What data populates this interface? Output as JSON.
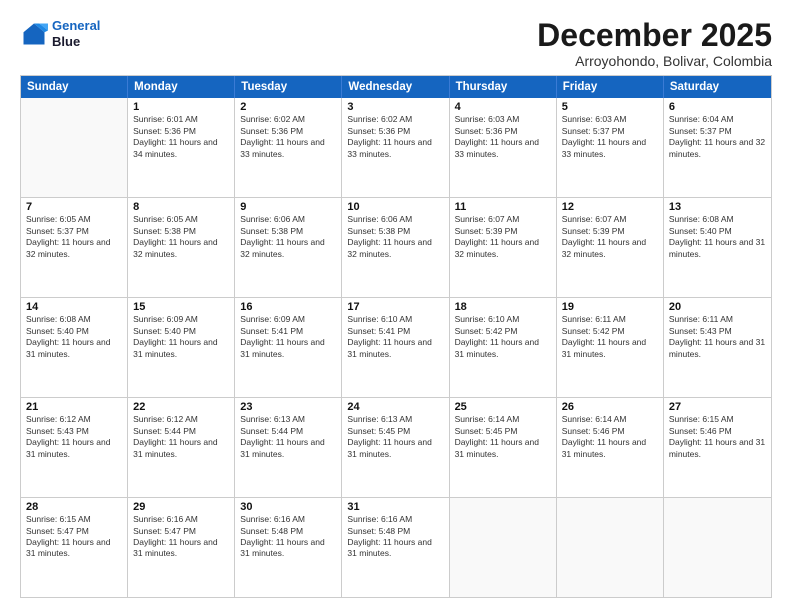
{
  "logo": {
    "line1": "General",
    "line2": "Blue"
  },
  "title": "December 2025",
  "subtitle": "Arroyohondo, Bolivar, Colombia",
  "headers": [
    "Sunday",
    "Monday",
    "Tuesday",
    "Wednesday",
    "Thursday",
    "Friday",
    "Saturday"
  ],
  "weeks": [
    [
      {
        "day": "",
        "sunrise": "",
        "sunset": "",
        "daylight": ""
      },
      {
        "day": "1",
        "sunrise": "Sunrise: 6:01 AM",
        "sunset": "Sunset: 5:36 PM",
        "daylight": "Daylight: 11 hours and 34 minutes."
      },
      {
        "day": "2",
        "sunrise": "Sunrise: 6:02 AM",
        "sunset": "Sunset: 5:36 PM",
        "daylight": "Daylight: 11 hours and 33 minutes."
      },
      {
        "day": "3",
        "sunrise": "Sunrise: 6:02 AM",
        "sunset": "Sunset: 5:36 PM",
        "daylight": "Daylight: 11 hours and 33 minutes."
      },
      {
        "day": "4",
        "sunrise": "Sunrise: 6:03 AM",
        "sunset": "Sunset: 5:36 PM",
        "daylight": "Daylight: 11 hours and 33 minutes."
      },
      {
        "day": "5",
        "sunrise": "Sunrise: 6:03 AM",
        "sunset": "Sunset: 5:37 PM",
        "daylight": "Daylight: 11 hours and 33 minutes."
      },
      {
        "day": "6",
        "sunrise": "Sunrise: 6:04 AM",
        "sunset": "Sunset: 5:37 PM",
        "daylight": "Daylight: 11 hours and 32 minutes."
      }
    ],
    [
      {
        "day": "7",
        "sunrise": "Sunrise: 6:05 AM",
        "sunset": "Sunset: 5:37 PM",
        "daylight": "Daylight: 11 hours and 32 minutes."
      },
      {
        "day": "8",
        "sunrise": "Sunrise: 6:05 AM",
        "sunset": "Sunset: 5:38 PM",
        "daylight": "Daylight: 11 hours and 32 minutes."
      },
      {
        "day": "9",
        "sunrise": "Sunrise: 6:06 AM",
        "sunset": "Sunset: 5:38 PM",
        "daylight": "Daylight: 11 hours and 32 minutes."
      },
      {
        "day": "10",
        "sunrise": "Sunrise: 6:06 AM",
        "sunset": "Sunset: 5:38 PM",
        "daylight": "Daylight: 11 hours and 32 minutes."
      },
      {
        "day": "11",
        "sunrise": "Sunrise: 6:07 AM",
        "sunset": "Sunset: 5:39 PM",
        "daylight": "Daylight: 11 hours and 32 minutes."
      },
      {
        "day": "12",
        "sunrise": "Sunrise: 6:07 AM",
        "sunset": "Sunset: 5:39 PM",
        "daylight": "Daylight: 11 hours and 32 minutes."
      },
      {
        "day": "13",
        "sunrise": "Sunrise: 6:08 AM",
        "sunset": "Sunset: 5:40 PM",
        "daylight": "Daylight: 11 hours and 31 minutes."
      }
    ],
    [
      {
        "day": "14",
        "sunrise": "Sunrise: 6:08 AM",
        "sunset": "Sunset: 5:40 PM",
        "daylight": "Daylight: 11 hours and 31 minutes."
      },
      {
        "day": "15",
        "sunrise": "Sunrise: 6:09 AM",
        "sunset": "Sunset: 5:40 PM",
        "daylight": "Daylight: 11 hours and 31 minutes."
      },
      {
        "day": "16",
        "sunrise": "Sunrise: 6:09 AM",
        "sunset": "Sunset: 5:41 PM",
        "daylight": "Daylight: 11 hours and 31 minutes."
      },
      {
        "day": "17",
        "sunrise": "Sunrise: 6:10 AM",
        "sunset": "Sunset: 5:41 PM",
        "daylight": "Daylight: 11 hours and 31 minutes."
      },
      {
        "day": "18",
        "sunrise": "Sunrise: 6:10 AM",
        "sunset": "Sunset: 5:42 PM",
        "daylight": "Daylight: 11 hours and 31 minutes."
      },
      {
        "day": "19",
        "sunrise": "Sunrise: 6:11 AM",
        "sunset": "Sunset: 5:42 PM",
        "daylight": "Daylight: 11 hours and 31 minutes."
      },
      {
        "day": "20",
        "sunrise": "Sunrise: 6:11 AM",
        "sunset": "Sunset: 5:43 PM",
        "daylight": "Daylight: 11 hours and 31 minutes."
      }
    ],
    [
      {
        "day": "21",
        "sunrise": "Sunrise: 6:12 AM",
        "sunset": "Sunset: 5:43 PM",
        "daylight": "Daylight: 11 hours and 31 minutes."
      },
      {
        "day": "22",
        "sunrise": "Sunrise: 6:12 AM",
        "sunset": "Sunset: 5:44 PM",
        "daylight": "Daylight: 11 hours and 31 minutes."
      },
      {
        "day": "23",
        "sunrise": "Sunrise: 6:13 AM",
        "sunset": "Sunset: 5:44 PM",
        "daylight": "Daylight: 11 hours and 31 minutes."
      },
      {
        "day": "24",
        "sunrise": "Sunrise: 6:13 AM",
        "sunset": "Sunset: 5:45 PM",
        "daylight": "Daylight: 11 hours and 31 minutes."
      },
      {
        "day": "25",
        "sunrise": "Sunrise: 6:14 AM",
        "sunset": "Sunset: 5:45 PM",
        "daylight": "Daylight: 11 hours and 31 minutes."
      },
      {
        "day": "26",
        "sunrise": "Sunrise: 6:14 AM",
        "sunset": "Sunset: 5:46 PM",
        "daylight": "Daylight: 11 hours and 31 minutes."
      },
      {
        "day": "27",
        "sunrise": "Sunrise: 6:15 AM",
        "sunset": "Sunset: 5:46 PM",
        "daylight": "Daylight: 11 hours and 31 minutes."
      }
    ],
    [
      {
        "day": "28",
        "sunrise": "Sunrise: 6:15 AM",
        "sunset": "Sunset: 5:47 PM",
        "daylight": "Daylight: 11 hours and 31 minutes."
      },
      {
        "day": "29",
        "sunrise": "Sunrise: 6:16 AM",
        "sunset": "Sunset: 5:47 PM",
        "daylight": "Daylight: 11 hours and 31 minutes."
      },
      {
        "day": "30",
        "sunrise": "Sunrise: 6:16 AM",
        "sunset": "Sunset: 5:48 PM",
        "daylight": "Daylight: 11 hours and 31 minutes."
      },
      {
        "day": "31",
        "sunrise": "Sunrise: 6:16 AM",
        "sunset": "Sunset: 5:48 PM",
        "daylight": "Daylight: 11 hours and 31 minutes."
      },
      {
        "day": "",
        "sunrise": "",
        "sunset": "",
        "daylight": ""
      },
      {
        "day": "",
        "sunrise": "",
        "sunset": "",
        "daylight": ""
      },
      {
        "day": "",
        "sunrise": "",
        "sunset": "",
        "daylight": ""
      }
    ]
  ]
}
